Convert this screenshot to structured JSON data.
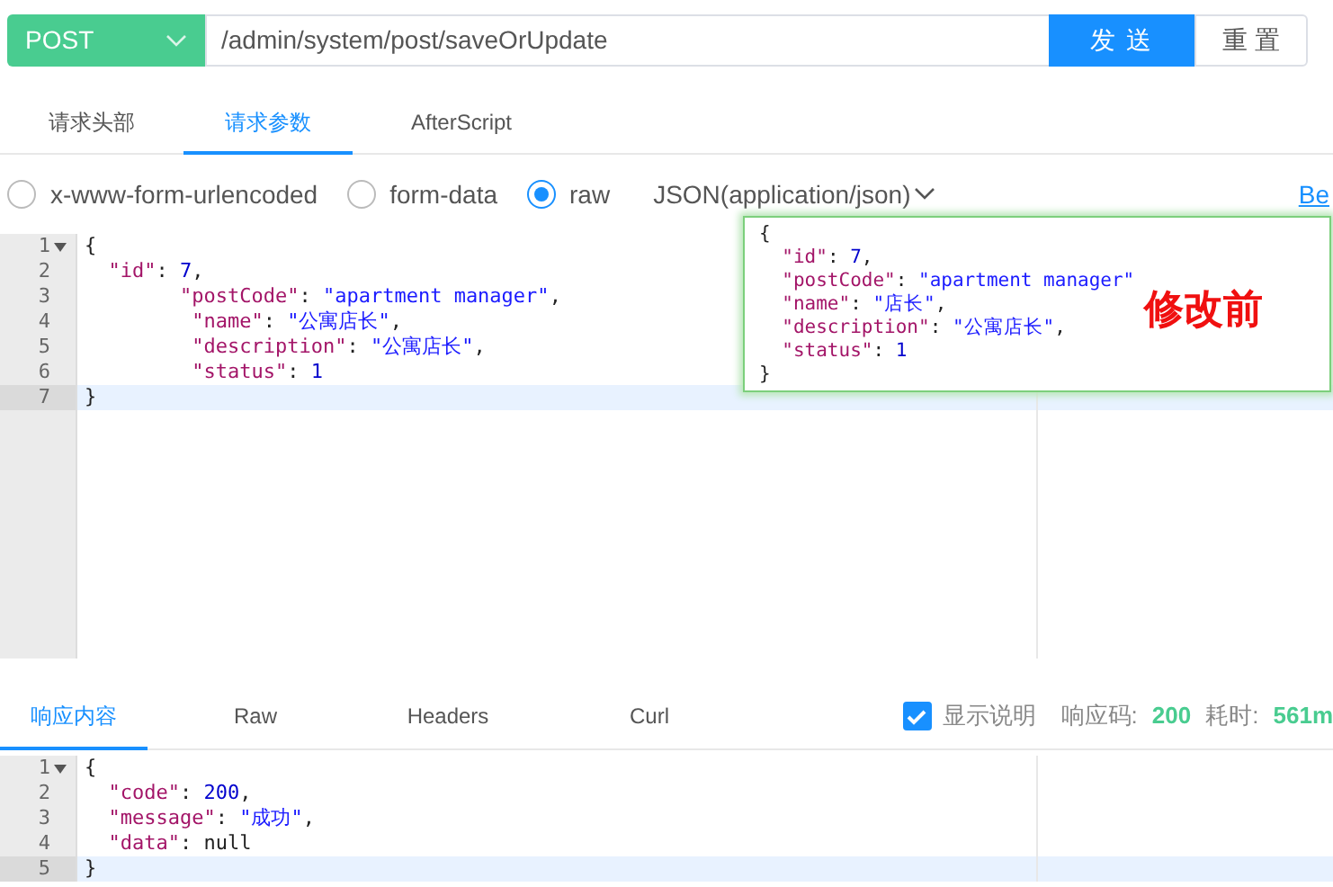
{
  "request_bar": {
    "method": "POST",
    "url": "/admin/system/post/saveOrUpdate",
    "send": "发 送",
    "reset": "重 置"
  },
  "request_tabs": [
    {
      "label": "请求头部",
      "selected": false
    },
    {
      "label": "请求参数",
      "selected": true
    },
    {
      "label": "AfterScript",
      "selected": false
    }
  ],
  "body_types": [
    {
      "label": "x-www-form-urlencoded",
      "selected": false
    },
    {
      "label": "form-data",
      "selected": false
    },
    {
      "label": "raw",
      "selected": true
    }
  ],
  "content_type": "JSON(application/json)",
  "beautify_link": "Be",
  "request_editor": [
    {
      "number": "1",
      "foldable": true,
      "active": false,
      "tokens": [
        {
          "kind": "punct",
          "text": "{"
        }
      ]
    },
    {
      "number": "2",
      "foldable": false,
      "active": false,
      "tokens": [
        {
          "kind": "key",
          "text": "  \"id\""
        },
        {
          "kind": "punct",
          "text": ": "
        },
        {
          "kind": "num",
          "text": "7"
        },
        {
          "kind": "punct",
          "text": ","
        }
      ]
    },
    {
      "number": "3",
      "foldable": false,
      "active": false,
      "tokens": [
        {
          "kind": "key",
          "text": "        \"postCode\""
        },
        {
          "kind": "punct",
          "text": ": "
        },
        {
          "kind": "str",
          "text": "\"apartment manager\""
        },
        {
          "kind": "punct",
          "text": ","
        }
      ]
    },
    {
      "number": "4",
      "foldable": false,
      "active": false,
      "tokens": [
        {
          "kind": "key",
          "text": "         \"name\""
        },
        {
          "kind": "punct",
          "text": ": "
        },
        {
          "kind": "str",
          "text": "\"公寓店长\""
        },
        {
          "kind": "punct",
          "text": ","
        }
      ]
    },
    {
      "number": "5",
      "foldable": false,
      "active": false,
      "tokens": [
        {
          "kind": "key",
          "text": "         \"description\""
        },
        {
          "kind": "punct",
          "text": ": "
        },
        {
          "kind": "str",
          "text": "\"公寓店长\""
        },
        {
          "kind": "punct",
          "text": ","
        }
      ]
    },
    {
      "number": "6",
      "foldable": false,
      "active": false,
      "tokens": [
        {
          "kind": "key",
          "text": "         \"status\""
        },
        {
          "kind": "punct",
          "text": ": "
        },
        {
          "kind": "num",
          "text": "1"
        }
      ]
    },
    {
      "number": "7",
      "foldable": false,
      "active": true,
      "tokens": [
        {
          "kind": "punct",
          "text": "}"
        }
      ]
    }
  ],
  "before_snapshot": {
    "caption": "修改前",
    "lines": [
      {
        "tokens": [
          {
            "kind": "punct",
            "text": "{"
          }
        ]
      },
      {
        "tokens": [
          {
            "kind": "key",
            "text": "  \"id\""
          },
          {
            "kind": "punct",
            "text": ": "
          },
          {
            "kind": "num",
            "text": "7"
          },
          {
            "kind": "punct",
            "text": ","
          }
        ]
      },
      {
        "tokens": [
          {
            "kind": "key",
            "text": "  \"postCode\""
          },
          {
            "kind": "punct",
            "text": ": "
          },
          {
            "kind": "str",
            "text": "\"apartment manager\""
          }
        ]
      },
      {
        "tokens": [
          {
            "kind": "key",
            "text": "  \"name\""
          },
          {
            "kind": "punct",
            "text": ": "
          },
          {
            "kind": "str",
            "text": "\"店长\""
          },
          {
            "kind": "punct",
            "text": ","
          }
        ]
      },
      {
        "tokens": [
          {
            "kind": "key",
            "text": "  \"description\""
          },
          {
            "kind": "punct",
            "text": ": "
          },
          {
            "kind": "str",
            "text": "\"公寓店长\""
          },
          {
            "kind": "punct",
            "text": ","
          }
        ]
      },
      {
        "tokens": [
          {
            "kind": "key",
            "text": "  \"status\""
          },
          {
            "kind": "punct",
            "text": ": "
          },
          {
            "kind": "num",
            "text": "1"
          }
        ]
      },
      {
        "tokens": [
          {
            "kind": "punct",
            "text": "}"
          }
        ]
      }
    ]
  },
  "response_tabs": [
    {
      "label": "响应内容",
      "selected": true
    },
    {
      "label": "Raw",
      "selected": false
    },
    {
      "label": "Headers",
      "selected": false
    },
    {
      "label": "Curl",
      "selected": false
    }
  ],
  "show_notes": {
    "label": "显示说明",
    "checked": true
  },
  "status_label": "响应码:",
  "status_code": "200",
  "time_label": "耗时:",
  "time_value": "561m",
  "response_editor": [
    {
      "number": "1",
      "foldable": true,
      "active": false,
      "tokens": [
        {
          "kind": "punct",
          "text": "{"
        }
      ]
    },
    {
      "number": "2",
      "foldable": false,
      "active": false,
      "tokens": [
        {
          "kind": "key",
          "text": "  \"code\""
        },
        {
          "kind": "punct",
          "text": ": "
        },
        {
          "kind": "num",
          "text": "200"
        },
        {
          "kind": "punct",
          "text": ","
        }
      ]
    },
    {
      "number": "3",
      "foldable": false,
      "active": false,
      "tokens": [
        {
          "kind": "key",
          "text": "  \"message\""
        },
        {
          "kind": "punct",
          "text": ": "
        },
        {
          "kind": "str",
          "text": "\"成功\""
        },
        {
          "kind": "punct",
          "text": ","
        }
      ]
    },
    {
      "number": "4",
      "foldable": false,
      "active": false,
      "tokens": [
        {
          "kind": "key",
          "text": "  \"data\""
        },
        {
          "kind": "punct",
          "text": ": "
        },
        {
          "kind": "plain",
          "text": "null"
        }
      ]
    },
    {
      "number": "5",
      "foldable": false,
      "active": true,
      "tokens": [
        {
          "kind": "punct",
          "text": "}"
        }
      ]
    }
  ]
}
